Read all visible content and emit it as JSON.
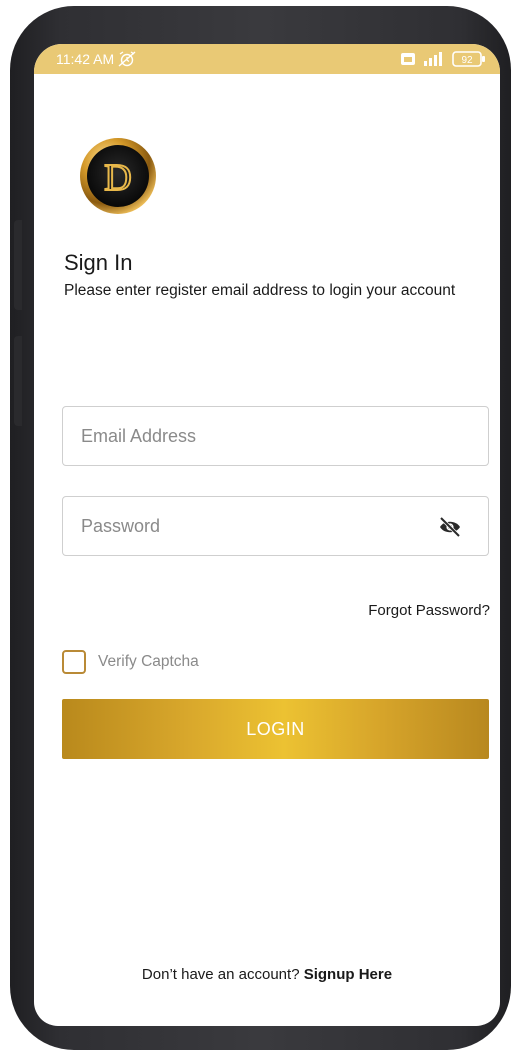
{
  "status_bar": {
    "time": "11:42 AM",
    "battery": "92",
    "icons": [
      "alarm-off-icon",
      "sim-icon",
      "signal-icon",
      "battery-icon"
    ]
  },
  "colors": {
    "status_bar_bg": "#e9c975",
    "accent_gold": "#d9a82c",
    "checkbox_border": "#b98a36"
  },
  "logo": {
    "letter": "D"
  },
  "header": {
    "title": "Sign In",
    "subtitle": "Please enter register email address to login your account"
  },
  "form": {
    "email_placeholder": "Email Address",
    "password_placeholder": "Password",
    "forgot_password": "Forgot Password?",
    "captcha_label": "Verify Captcha",
    "login_label": "LOGIN"
  },
  "footer": {
    "prompt": "Don’t have an account?",
    "signup_link": "Signup Here"
  }
}
